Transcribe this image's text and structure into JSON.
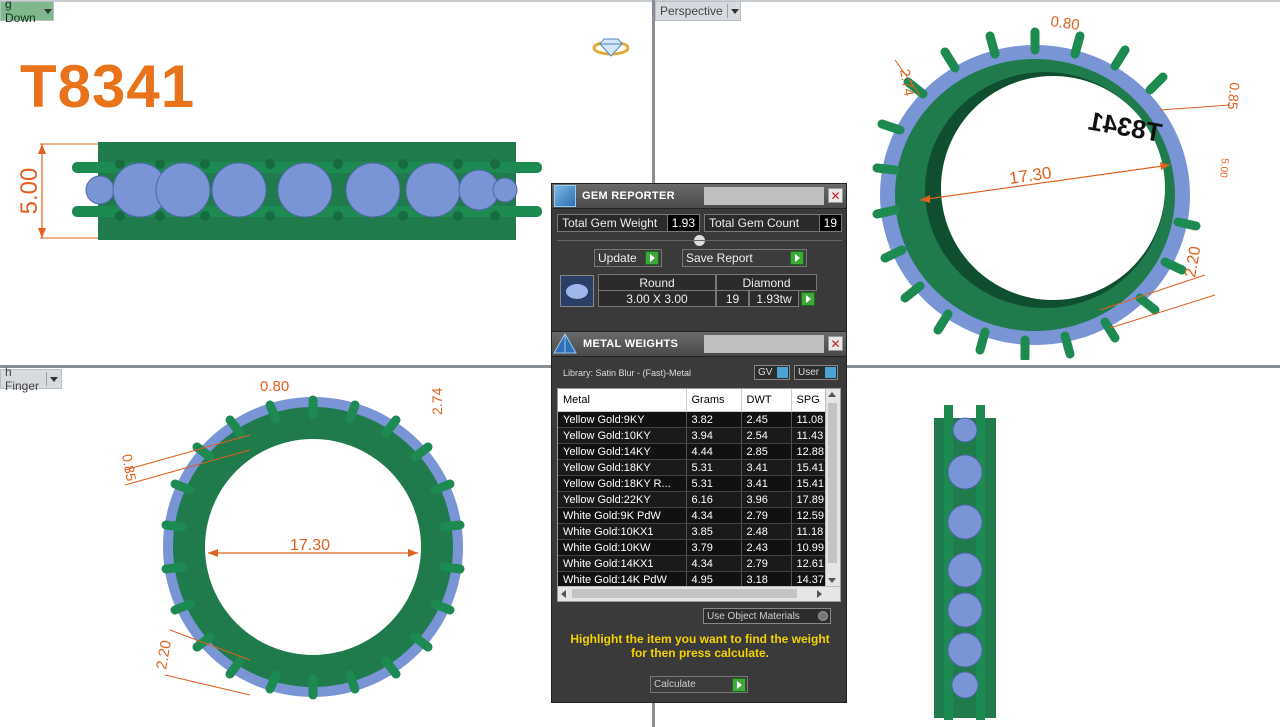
{
  "viewports": {
    "top_left_label": "g Down",
    "top_right_label": "Perspective",
    "bottom_left_label": "h Finger"
  },
  "design_code": "T8341",
  "dimensions": {
    "height": "5.00",
    "prong_width_top": "0.80",
    "side_274": "2.74",
    "side_085": "0.85",
    "inner_diameter": "17.30",
    "band_220": "2.20",
    "small_500": "5.00"
  },
  "gem_reporter": {
    "title": "GEM REPORTER",
    "total_gem_weight_label": "Total Gem Weight",
    "total_gem_weight": "1.93",
    "total_gem_count_label": "Total Gem Count",
    "total_gem_count": "19",
    "update_label": "Update",
    "save_report_label": "Save Report",
    "gem_shape": "Round",
    "gem_type": "Diamond",
    "gem_size": "3.00 X 3.00",
    "gem_count": "19",
    "gem_weight": "1.93tw"
  },
  "metal_weights": {
    "title": "METAL WEIGHTS",
    "library": "Library: Satin Blur - (Fast)-Metal",
    "gv_label": "GV",
    "user_label": "User",
    "columns": [
      "Metal",
      "Grams",
      "DWT",
      "SPG"
    ],
    "rows": [
      [
        "Yellow Gold:9KY",
        "3.82",
        "2.45",
        "11.08"
      ],
      [
        "Yellow Gold:10KY",
        "3.94",
        "2.54",
        "11.43"
      ],
      [
        "Yellow Gold:14KY",
        "4.44",
        "2.85",
        "12.88"
      ],
      [
        "Yellow Gold:18KY",
        "5.31",
        "3.41",
        "15.41"
      ],
      [
        "Yellow Gold:18KY R...",
        "5.31",
        "3.41",
        "15.41"
      ],
      [
        "Yellow Gold:22KY",
        "6.16",
        "3.96",
        "17.89"
      ],
      [
        "White Gold:9K PdW",
        "4.34",
        "2.79",
        "12.59"
      ],
      [
        "White Gold:10KX1",
        "3.85",
        "2.48",
        "11.18"
      ],
      [
        "White Gold:10KW",
        "3.79",
        "2.43",
        "10.99"
      ],
      [
        "White Gold:14KX1",
        "4.34",
        "2.79",
        "12.61"
      ],
      [
        "White Gold:14K PdW",
        "4.95",
        "3.18",
        "14.37"
      ]
    ],
    "use_object_materials": "Use Object Materials",
    "hint": "Highlight the item you want to find the weight for then press calculate.",
    "calculate_label": "Calculate"
  },
  "colors": {
    "metal_green": "#1f7a4c",
    "gem_blue": "#7a95d6",
    "dimension_orange": "#e0601e",
    "title_orange": "#e8731a"
  }
}
